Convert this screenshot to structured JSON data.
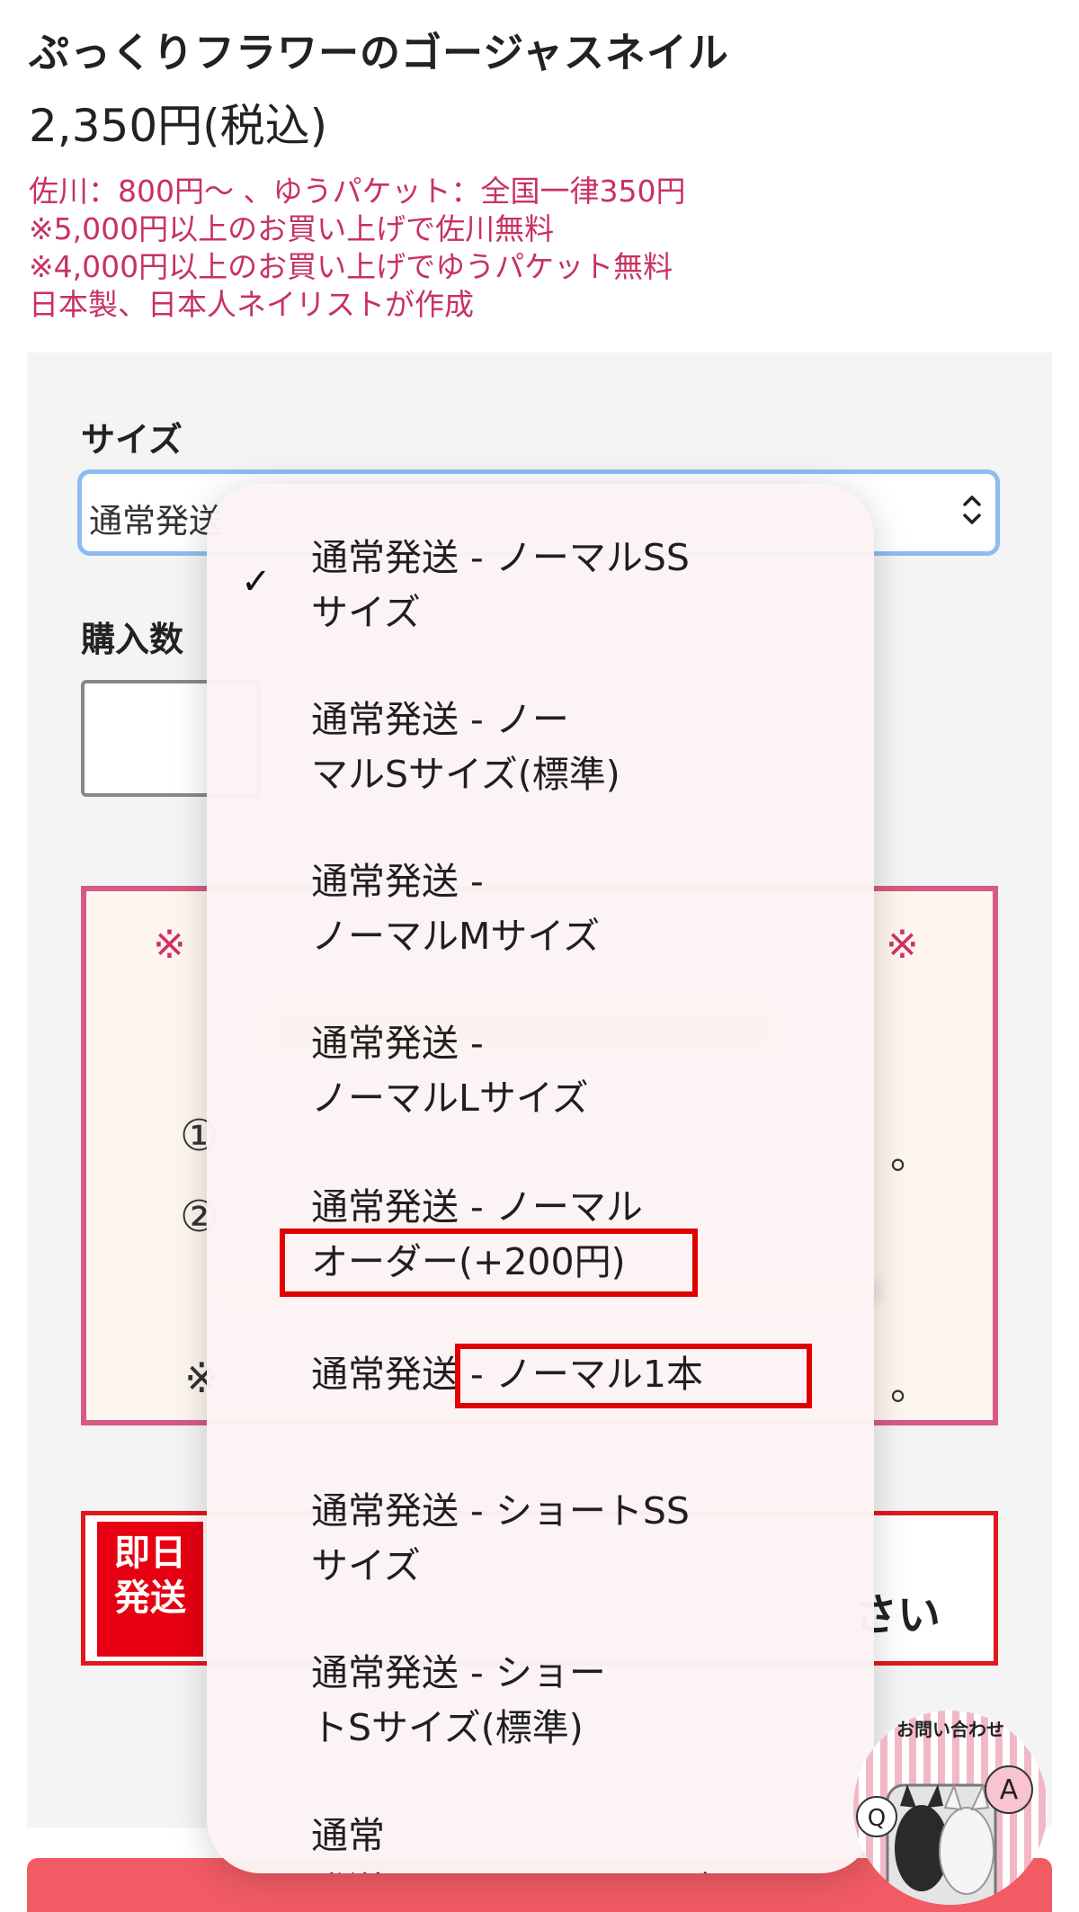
{
  "product": {
    "title": "ぷっくりフラワーのゴージャスネイル",
    "price": "2,350円(税込)",
    "shipping_lines": [
      "佐川：800円〜 、ゆうパケット：全国一律350円",
      "※5,000円以上のお買い上げで佐川無料",
      "※4,000円以上のお買い上げでゆうパケット無料",
      "日本製、日本人ネイリストが作成"
    ]
  },
  "form": {
    "size_label": "サイズ",
    "size_selected": "通常発送",
    "quantity_label": "購入数"
  },
  "notice": {
    "mark_left": "※",
    "mark_right": "※",
    "num1": "①",
    "num2": "②",
    "tail1": "。",
    "tail2": "。",
    "ast": "※"
  },
  "sameday": {
    "badge_line1": "即日",
    "badge_line2": "発送",
    "tail_text": "さい"
  },
  "dropdown": {
    "options": [
      {
        "lines": [
          "通常発送 - ノーマルSS",
          "サイズ"
        ],
        "selected": true
      },
      {
        "lines": [
          "通常発送 - ノー",
          "マルSサイズ(標準)"
        ]
      },
      {
        "lines": [
          "通常発送 -",
          "ノーマルMサイズ"
        ]
      },
      {
        "lines": [
          "通常発送 -",
          "ノーマルLサイズ"
        ]
      },
      {
        "lines": [
          "通常発送 - ノーマル",
          "オーダー(+200円)"
        ]
      },
      {
        "lines": [
          "通常発送 - ノーマル1本"
        ]
      },
      {
        "lines": [
          "通常発送 - ショートSS",
          "サイズ"
        ]
      },
      {
        "lines": [
          "通常発送 - ショー",
          "トSサイズ(標準)"
        ]
      },
      {
        "lines": [
          "通常",
          "発送 - ショートMサイズ"
        ]
      }
    ],
    "check_glyph": "✓"
  },
  "contact": {
    "label": "お問い合わせ",
    "q": "Q",
    "a": "A"
  },
  "colors": {
    "accent_pink": "#c8325f",
    "highlight_red": "#e10000",
    "select_border": "#8cbcf0",
    "cart_red": "#f15b64"
  }
}
